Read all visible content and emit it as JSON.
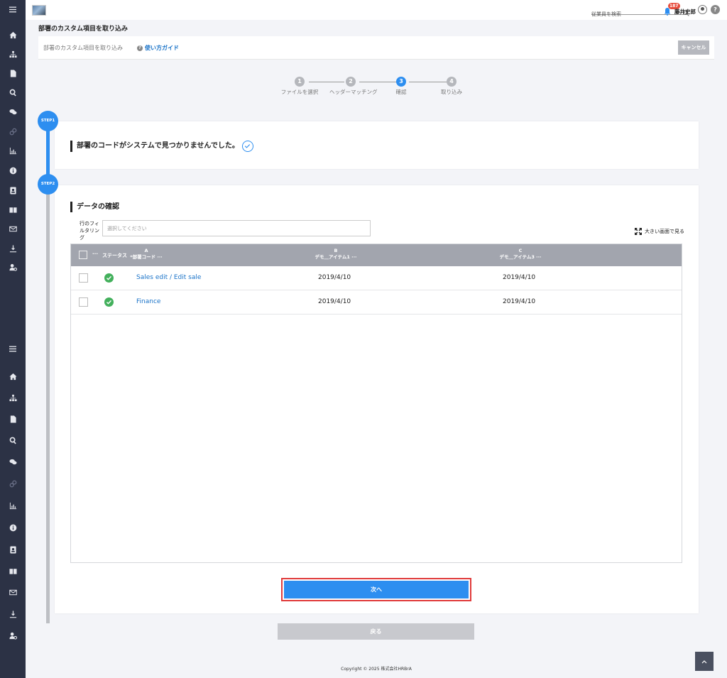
{
  "topbar": {
    "search_placeholder": "従業員を検索",
    "notification_count": "187",
    "user_name": "藤井史郎",
    "help_label": "?"
  },
  "page": {
    "title": "部署のカスタム項目を取り込み",
    "subtitle": "部署のカスタム項目を取り込み",
    "guide_label": "使い方ガイド",
    "cancel_label": "キャンセル"
  },
  "wizard": {
    "steps": [
      {
        "num": "1",
        "label": "ファイルを選択",
        "active": false
      },
      {
        "num": "2",
        "label": "ヘッダーマッチング",
        "active": false
      },
      {
        "num": "3",
        "label": "確認",
        "active": true
      },
      {
        "num": "4",
        "label": "取り込み",
        "active": false
      }
    ]
  },
  "step1": {
    "badge": "STEP1",
    "message": "部署のコードがシステムで見つかりませんでした。"
  },
  "step2": {
    "badge": "STEP2",
    "title": "データの確認",
    "filter_label": "行のフィルタリング",
    "filter_placeholder": "選択してください",
    "big_view_label": "大きい画面で見る",
    "table": {
      "header_dots": "···",
      "status_header": "ステータス",
      "columns": [
        {
          "letter": "A",
          "name": "*部署コード ···"
        },
        {
          "letter": "B",
          "name": "デモ＿アイテム1 ···"
        },
        {
          "letter": "C",
          "name": "デモ＿アイテム3 ···"
        }
      ],
      "rows": [
        {
          "code": "Sales edit / Edit sale",
          "b": "2019/4/10",
          "c": "2019/4/10"
        },
        {
          "code": "Finance",
          "b": "2019/4/10",
          "c": "2019/4/10"
        }
      ]
    },
    "next_label": "次へ",
    "back_label": "戻る"
  },
  "footer": {
    "copyright": "Copyright © 2025 株式会社HRBrA"
  },
  "colors": {
    "sidebar": "#2c3245",
    "accent": "#2d8ef0",
    "success": "#43b05c",
    "highlight": "#e03b3b"
  },
  "icons": {
    "sidebar": [
      "menu-icon",
      "home-icon",
      "org-chart-icon",
      "document-icon",
      "search-icon",
      "chat-icon",
      "link-icon",
      "chart-icon",
      "info-icon",
      "contact-icon",
      "book-icon",
      "mail-icon",
      "download-icon",
      "user-settings-icon"
    ]
  }
}
